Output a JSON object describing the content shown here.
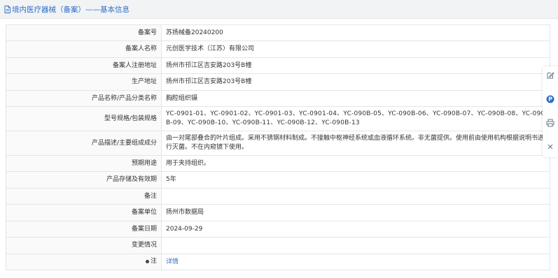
{
  "header": {
    "title": "境内医疗器械（备案）——基本信息",
    "icon": "document-icon",
    "accent": "#2f6fc7"
  },
  "fields": {
    "filing_no": {
      "label": "备案号",
      "value": "苏扬械备20240200"
    },
    "filer_name": {
      "label": "备案人名称",
      "value": "元创医学技术（江苏）有限公司"
    },
    "filer_address": {
      "label": "备案人注册地址",
      "value": "扬州市邗江区吉安路203号B幢"
    },
    "production_address": {
      "label": "生产地址",
      "value": "扬州市邗江区吉安路203号B幢"
    },
    "product_name": {
      "label": "产品名称/产品分类名称",
      "value": "胸腔组织镊"
    },
    "model_spec": {
      "label": "型号规格/包装规格",
      "value": "YC-0901-01、YC-0901-02、YC-0901-03、YC-0901-04、YC-090B-05、YC-090B-06、YC-090B-07、YC-090B-08、YC-090B-09、YC-090B-10、YC-090B-11、YC-090B-12、YC-090B-13"
    },
    "description": {
      "label": "产品描述/主要组成成分",
      "value": "由一对尾部叠合的叶片组成。采用不锈钢材料制成。不接触中枢神经系统或血液循环系统。非无菌提供。使用前由使用机构根据说明书进行灭菌。不在内窥镜下使用。"
    },
    "intended_use": {
      "label": "预期用途",
      "value": "用于夹持组织。"
    },
    "storage": {
      "label": "产品存储及有效期",
      "value": "5年"
    },
    "remarks": {
      "label": "备注",
      "value": ""
    },
    "filing_unit": {
      "label": "备案单位",
      "value": "扬州市数据局"
    },
    "filing_date": {
      "label": "备案日期",
      "value": "2024-09-29"
    },
    "change_info": {
      "label": "变更情况",
      "value": ""
    },
    "note": {
      "label": "注",
      "link": "详情",
      "icon": "bullet-icon"
    }
  },
  "side_tools": [
    "edit-icon",
    "parking-icon",
    "print-icon",
    "close-icon"
  ]
}
